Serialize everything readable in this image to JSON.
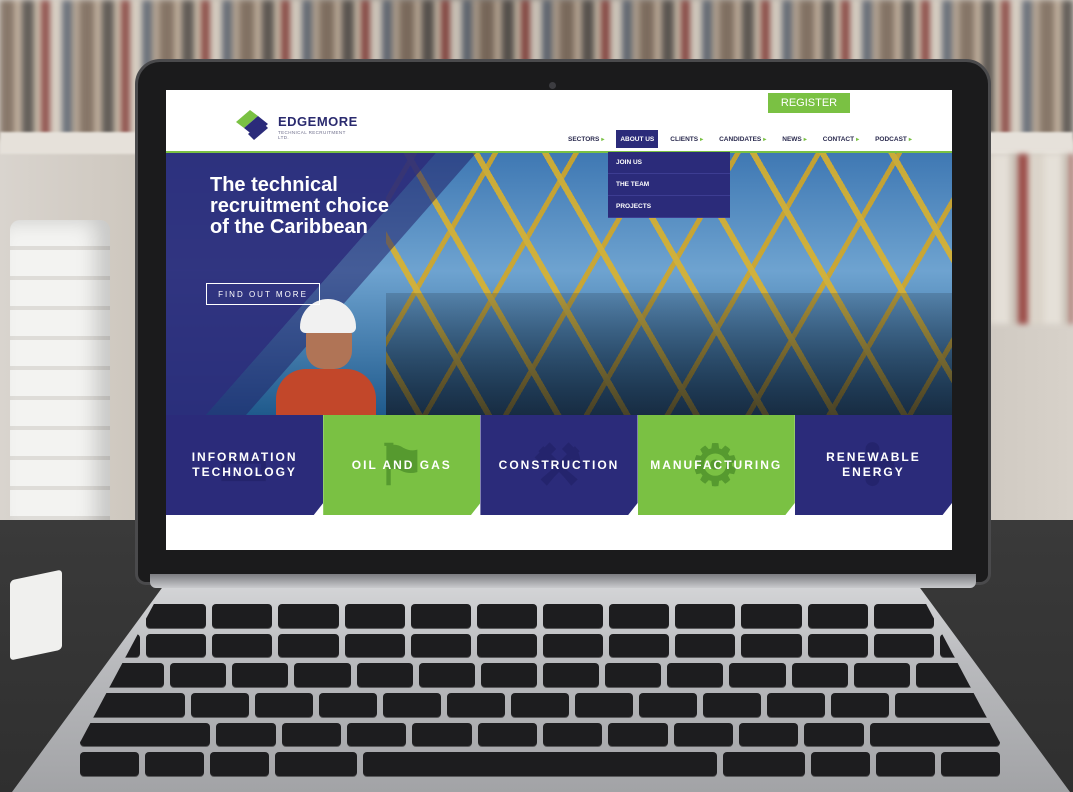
{
  "site": {
    "logo_text": "EDGEMORE",
    "logo_subtext": "TECHNICAL RECRUITMENT LTD.",
    "register_label": "REGISTER",
    "nav": [
      {
        "label": "SECTORS"
      },
      {
        "label": "ABOUT US",
        "active": true
      },
      {
        "label": "CLIENTS"
      },
      {
        "label": "CANDIDATES"
      },
      {
        "label": "NEWS"
      },
      {
        "label": "CONTACT"
      },
      {
        "label": "PODCAST"
      }
    ],
    "dropdown": [
      {
        "label": "JOIN US"
      },
      {
        "label": "THE TEAM"
      },
      {
        "label": "PROJECTS"
      }
    ],
    "hero": {
      "headline": "The technical recruitment choice of the Caribbean",
      "cta_label": "FIND OUT MORE"
    },
    "sectors": [
      {
        "label": "INFORMATION TECHNOLOGY",
        "color": "blue",
        "icon": "laptop-icon"
      },
      {
        "label": "OIL AND GAS",
        "color": "green",
        "icon": "oil-rig-icon"
      },
      {
        "label": "CONSTRUCTION",
        "color": "blue",
        "icon": "crane-icon"
      },
      {
        "label": "MANUFACTURING",
        "color": "green",
        "icon": "gears-icon"
      },
      {
        "label": "RENEWABLE ENERGY",
        "color": "blue",
        "icon": "wind-turbine-icon"
      }
    ]
  },
  "colors": {
    "brand_blue": "#2b2b7a",
    "brand_green": "#7ac143"
  }
}
